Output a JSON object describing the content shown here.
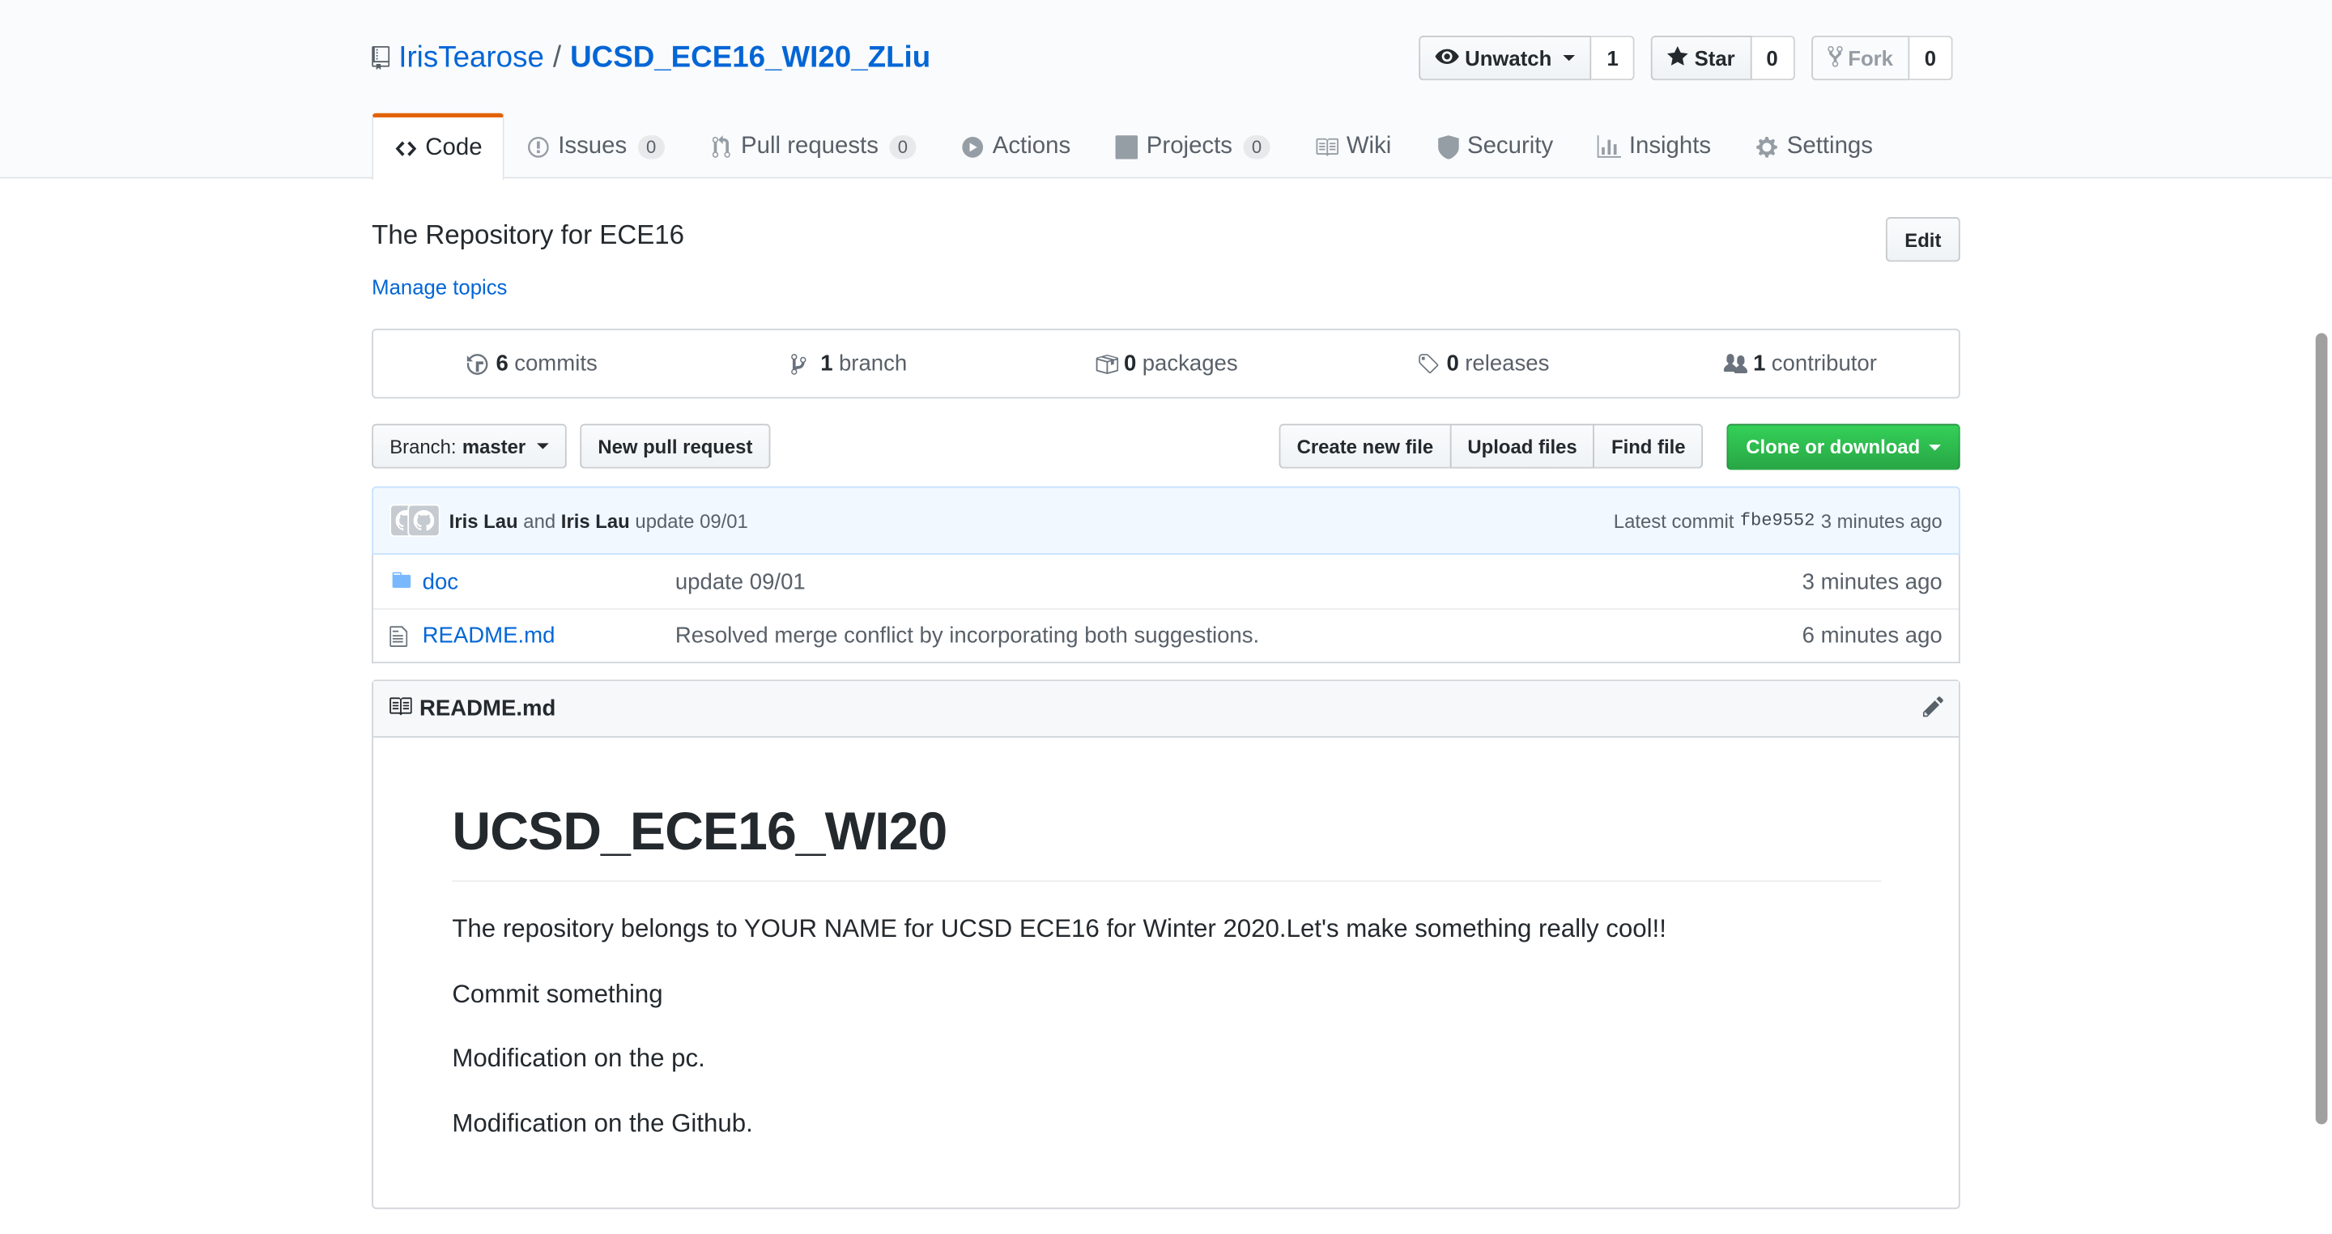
{
  "repo": {
    "owner": "IrisTearose",
    "separator": "/",
    "name": "UCSD_ECE16_WI20_ZLiu"
  },
  "actions": {
    "watch_label": "Unwatch",
    "watch_count": "1",
    "star_label": "Star",
    "star_count": "0",
    "fork_label": "Fork",
    "fork_count": "0"
  },
  "tabs": [
    {
      "label": "Code",
      "icon": "code-icon",
      "selected": true
    },
    {
      "label": "Issues",
      "icon": "issue-icon",
      "count": "0"
    },
    {
      "label": "Pull requests",
      "icon": "pull-request-icon",
      "count": "0"
    },
    {
      "label": "Actions",
      "icon": "play-icon"
    },
    {
      "label": "Projects",
      "icon": "project-icon",
      "count": "0"
    },
    {
      "label": "Wiki",
      "icon": "book-icon"
    },
    {
      "label": "Security",
      "icon": "shield-icon"
    },
    {
      "label": "Insights",
      "icon": "graph-icon"
    },
    {
      "label": "Settings",
      "icon": "gear-icon"
    }
  ],
  "about": {
    "description": "The Repository for ECE16",
    "manage_topics": "Manage topics",
    "edit_label": "Edit"
  },
  "summary": {
    "commits_count": "6",
    "commits_label": "commits",
    "branch_count": "1",
    "branch_label": "branch",
    "packages_count": "0",
    "packages_label": "packages",
    "releases_count": "0",
    "releases_label": "releases",
    "contributor_count": "1",
    "contributor_label": "contributor"
  },
  "filebar": {
    "branch_prefix": "Branch:",
    "branch_name": "master",
    "new_pr": "New pull request",
    "create_file": "Create new file",
    "upload_files": "Upload files",
    "find_file": "Find file",
    "clone": "Clone or download"
  },
  "commit": {
    "author1": "Iris Lau",
    "and": "and",
    "author2": "Iris Lau",
    "message": "update 09/01",
    "latest_label": "Latest commit",
    "sha": "fbe9552",
    "age": "3 minutes ago"
  },
  "files": [
    {
      "name": "doc",
      "type": "folder",
      "message": "update 09/01",
      "age": "3 minutes ago"
    },
    {
      "name": "README.md",
      "type": "file",
      "message": "Resolved merge conflict by incorporating both suggestions.",
      "age": "6 minutes ago"
    }
  ],
  "readme": {
    "filename": "README.md",
    "heading": "UCSD_ECE16_WI20",
    "paragraphs": [
      "The repository belongs to YOUR NAME for UCSD ECE16 for Winter 2020.Let's make something really cool!!",
      "Commit something",
      "Modification on the pc.",
      "Modification on the Github."
    ]
  },
  "colors": {
    "link": "#0366d6",
    "accent_tab": "#e36209",
    "clone_green": "#28a745",
    "commit_bg": "#f1f8ff"
  }
}
